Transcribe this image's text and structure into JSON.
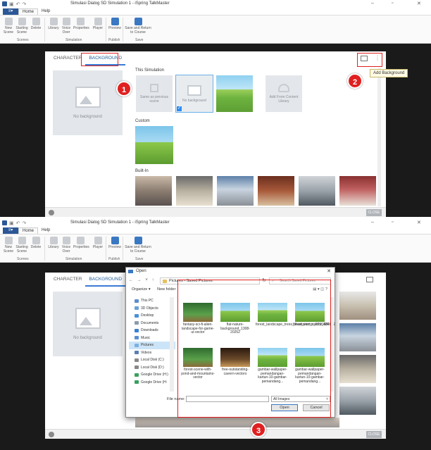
{
  "app": {
    "window_title": "Simulasi Dialog SD Simulation 1 - iSpring TalkMaster",
    "file_tab": "",
    "tabs": [
      "Home",
      "Help"
    ],
    "ribbon": {
      "buttons": [
        "New Scene",
        "Starting Scene",
        "Delete",
        "Library",
        "Voice Over",
        "Properties",
        "Player",
        "Preview",
        "Save and Return to Course"
      ],
      "groups": [
        "Scenes",
        "Simulation",
        "Publish",
        "Save"
      ]
    }
  },
  "dialog": {
    "tabs": [
      "CHARACTER",
      "BACKGROUND"
    ],
    "active_tab": "BACKGROUND",
    "preview_label": "No background",
    "sections": [
      "This Simulation",
      "Custom",
      "Built-In"
    ],
    "this_simulation": [
      "Same as previous scene",
      "No background",
      "",
      "Add From Content Library"
    ],
    "tooltip": "Add Background",
    "close_label": "CLOSE"
  },
  "markers": [
    "1",
    "2",
    "3"
  ],
  "open_dialog": {
    "title": "Open",
    "path": [
      "Pictures",
      "Saved Pictures"
    ],
    "search_placeholder": "Search Saved Pictures",
    "organize": "Organize",
    "new_folder": "New folder",
    "sidebar": [
      "This PC",
      "3D Objects",
      "Desktop",
      "Documents",
      "Downloads",
      "Music",
      "Pictures",
      "Videos",
      "Local Disk (C:)",
      "Local Disk (D:)",
      "Google Drive (H:)",
      "Google Drive (H:"
    ],
    "files": [
      "fantasy-sci-fi-alien-landscape-for-game-ui-vector",
      "flat-nature-background_1308-20252",
      "forest_landscape_trees_illustration_vector_584822",
      "forest_vector_6016406",
      "forest-scene-with-pond-and-mountains-vector",
      "free-outstanding-cavern-vectors",
      "gambar-wallpaper-pemandangan-kartun-10-gambar-pemandang...",
      "gambar-wallpaper-pemandangan-kartun-10-gambar-pemandang..."
    ],
    "file_name_label": "File name:",
    "file_name_value": "",
    "filter": "All Images",
    "open_button": "Open",
    "cancel_button": "Cancel"
  },
  "colors": {
    "accent": "#2b5797",
    "highlight": "#e02020",
    "selection": "#6ab0e8"
  }
}
